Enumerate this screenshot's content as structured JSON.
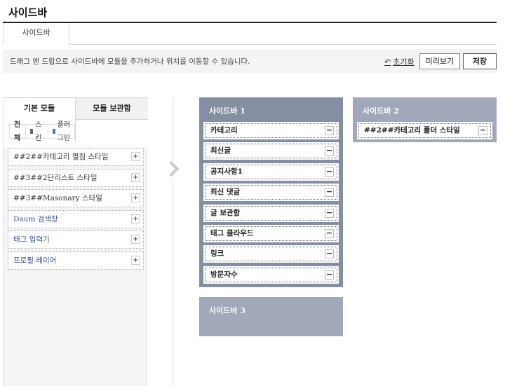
{
  "page": {
    "title": "사이드바"
  },
  "tabs": [
    {
      "label": "사이드바"
    }
  ],
  "info": {
    "text": "드래그 앤 드랍으로 사이드바에 모듈을 추가하거나 위치를 이동할 수 있습니다.",
    "reset_label": "초기화",
    "preview_label": "미리보기",
    "save_label": "저장"
  },
  "module_panel": {
    "tabs": [
      {
        "label": "기본 모듈"
      },
      {
        "label": "모듈 보관함"
      }
    ],
    "filters": {
      "all": "전체",
      "skin": "스킨",
      "plugin": "플러그인"
    },
    "items": [
      {
        "label": "##2##카테고리 펼침 스타일",
        "kind": "skin"
      },
      {
        "label": "##3##2단리스트 스타일",
        "kind": "skin"
      },
      {
        "label": "##3##Masonary 스타일",
        "kind": "skin"
      },
      {
        "label": "Daum 검색창",
        "kind": "plugin"
      },
      {
        "label": "태그 입력기",
        "kind": "plugin"
      },
      {
        "label": "프로필 레이어",
        "kind": "plugin"
      }
    ],
    "add_symbol": "+"
  },
  "sidebars": [
    {
      "title": "사이드바 1",
      "items": [
        {
          "label": "카테고리"
        },
        {
          "label": "최신글"
        },
        {
          "label": "공지사항1"
        },
        {
          "label": "최신 댓글"
        },
        {
          "label": "글 보관함"
        },
        {
          "label": "태그 클라우드"
        },
        {
          "label": "링크"
        },
        {
          "label": "방문자수"
        }
      ]
    },
    {
      "title": "사이드바 2",
      "items": [
        {
          "label": "##2##카테고리 폴더 스타일"
        }
      ]
    },
    {
      "title": "사이드바 3",
      "items": []
    }
  ],
  "remove_symbol": "−",
  "colors": {
    "sidebar_active": "#868fa2",
    "sidebar_inactive": "#a0a8b9",
    "plugin_text": "#3c5292"
  }
}
